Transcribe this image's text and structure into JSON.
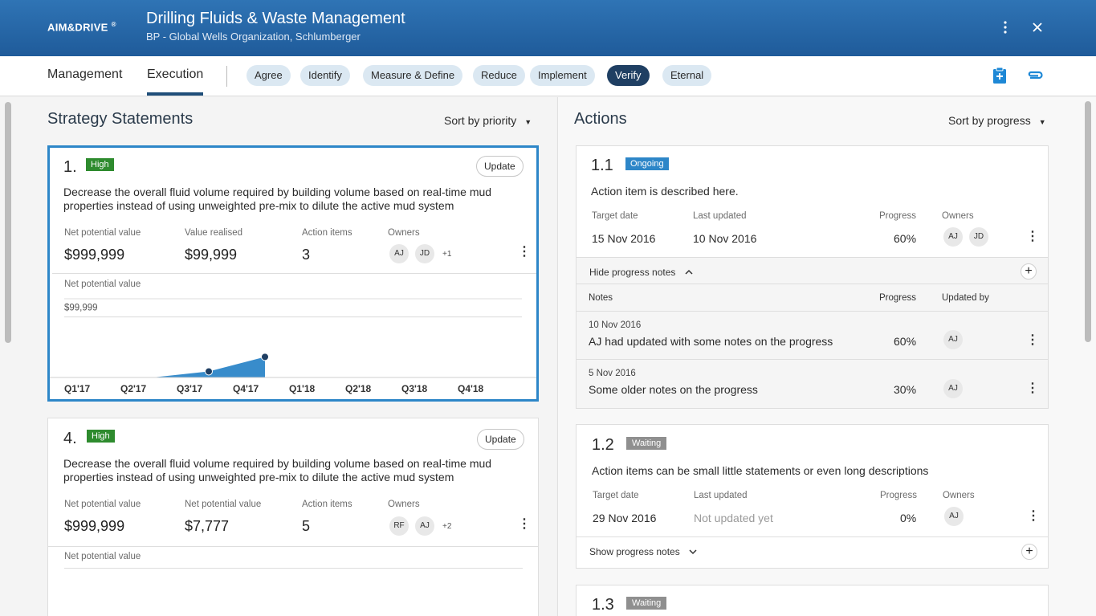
{
  "header": {
    "brand": "AIM&DRIVE",
    "brand_mark": "®",
    "title": "Drilling Fluids & Waste Management",
    "subtitle": "BP - Global Wells Organization, Schlumberger"
  },
  "nav": {
    "tabs": [
      "Management",
      "Execution"
    ],
    "active_tab": "Execution",
    "stages": [
      "Agree",
      "Identify",
      "Measure & Define",
      "Reduce",
      "Implement",
      "Verify",
      "Eternal"
    ],
    "active_stage": "Verify"
  },
  "strategy": {
    "title": "Strategy Statements",
    "sort_label": "Sort by priority",
    "cards": [
      {
        "number": "1.",
        "priority": "High",
        "update_label": "Update",
        "description_line1": "Decrease the overall fluid volume required by building volume based on real-time mud",
        "description_line2": "properties instead of using unweighted pre-mix to dilute the active mud system",
        "metric1_label": "Net potential value",
        "metric1_value": "$999,999",
        "metric2_label": "Value realised",
        "metric2_value": "$99,999",
        "metric3_label": "Action items",
        "metric3_value": "3",
        "owners_label": "Owners",
        "owners": [
          "AJ",
          "JD"
        ],
        "owners_more": "+1",
        "chart_label": "Net potential value"
      },
      {
        "number": "4.",
        "priority": "High",
        "update_label": "Update",
        "description_line1": "Decrease the overall fluid volume required by building volume based on real-time mud",
        "description_line2": "properties instead of using unweighted pre-mix to dilute the active mud system",
        "metric1_label": "Net potential value",
        "metric1_value": "$999,999",
        "metric2_label": "Net potential value",
        "metric2_value": "$7,777",
        "metric3_label": "Action items",
        "metric3_value": "5",
        "owners_label": "Owners",
        "owners": [
          "RF",
          "AJ"
        ],
        "owners_more": "+2",
        "chart_label": "Net potential value"
      }
    ]
  },
  "chart_data": {
    "type": "area",
    "title": "Net potential value",
    "categories": [
      "Q1'17",
      "Q2'17",
      "Q3'17",
      "Q4'17",
      "Q1'18",
      "Q2'18",
      "Q3'18",
      "Q4'18"
    ],
    "series": [
      {
        "values": [
          null,
          0,
          10000,
          34000,
          null,
          null,
          null,
          null
        ]
      }
    ],
    "y_reference_label": "$99,999",
    "y_reference_value": 99999,
    "ylim": [
      0,
      130000
    ],
    "color": "#2d86c8"
  },
  "actions": {
    "title": "Actions",
    "sort_label": "Sort by progress",
    "items": [
      {
        "number": "1.1",
        "status": "Ongoing",
        "description": "Action item is described here.",
        "target_label": "Target date",
        "target_value": "15 Nov 2016",
        "updated_label": "Last updated",
        "updated_value": "10 Nov 2016",
        "progress_label": "Progress",
        "progress_value": "60%",
        "owners_label": "Owners",
        "owners": [
          "AJ",
          "JD"
        ],
        "notes_toggle": "Hide progress notes",
        "notes_header": {
          "notes": "Notes",
          "progress": "Progress",
          "updated_by": "Updated by"
        },
        "notes": [
          {
            "date": "10 Nov 2016",
            "text": "AJ had updated with  some notes on the progress",
            "progress": "60%",
            "by": "AJ"
          },
          {
            "date": "5 Nov 2016",
            "text": "Some older notes on the progress",
            "progress": "30%",
            "by": "AJ"
          }
        ]
      },
      {
        "number": "1.2",
        "status": "Waiting",
        "description": "Action items can be small little statements or even long descriptions",
        "target_label": "Target date",
        "target_value": "29 Nov 2016",
        "updated_label": "Last updated",
        "updated_value": "Not updated yet",
        "progress_label": "Progress",
        "progress_value": "0%",
        "owners_label": "Owners",
        "owners": [
          "AJ"
        ],
        "notes_toggle": "Show progress notes"
      },
      {
        "number": "1.3",
        "status": "Waiting"
      }
    ]
  }
}
